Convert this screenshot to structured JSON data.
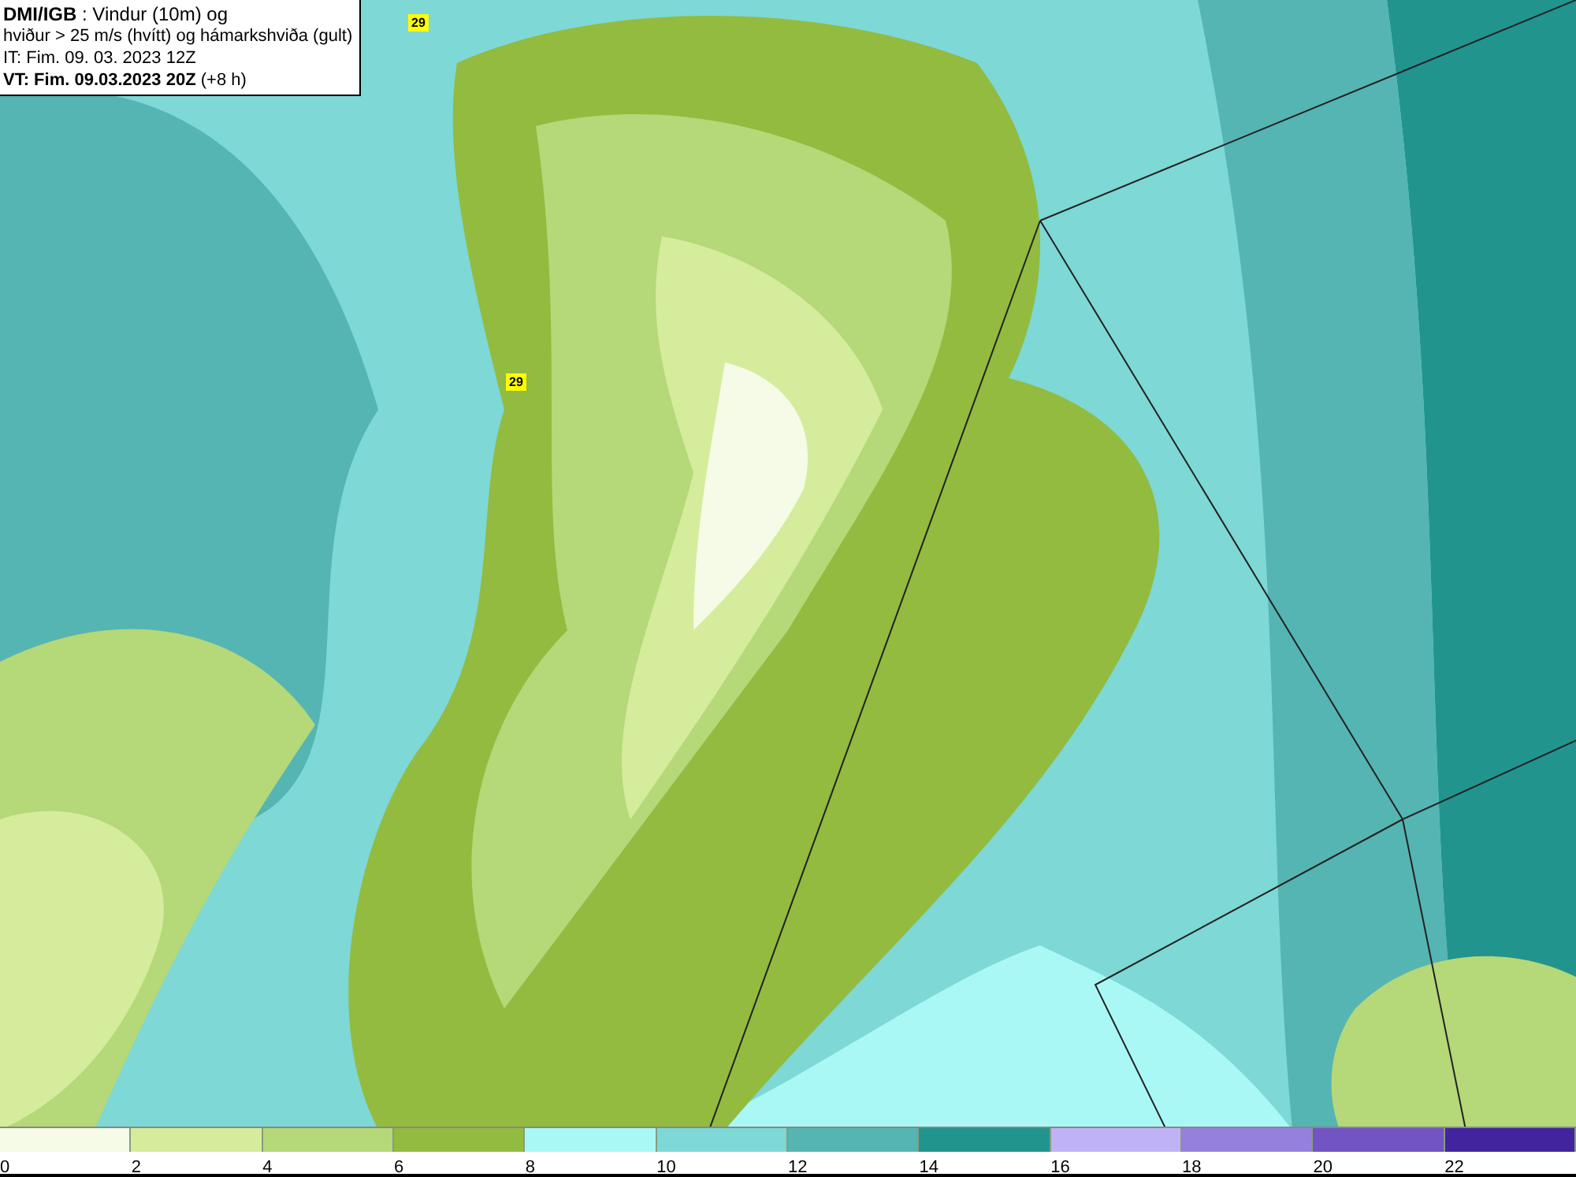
{
  "title_box": {
    "lines": [
      "**DMI/IGB** : Vindur (10m) og",
      "hviður > 25 m/s (hvítt) og hámarkshviða (gult)",
      "IT: Fim. 09. 03. 2023 12Z",
      "**VT: Fim. 09.03.2023 20Z** (+8 h)"
    ]
  },
  "map": {
    "gust_labels": [
      {
        "text": "29"
      },
      {
        "text": "29"
      }
    ]
  },
  "legend": {
    "bins": [
      {
        "color": "#f5fbe6"
      },
      {
        "color": "#d5ec9c"
      },
      {
        "color": "#b5d878"
      },
      {
        "color": "#92bb40"
      },
      {
        "color": "#aaf8f6"
      },
      {
        "color": "#7dd8d6"
      },
      {
        "color": "#55b5b2"
      },
      {
        "color": "#21948e"
      },
      {
        "color": "#c0b3f5"
      },
      {
        "color": "#9580de"
      },
      {
        "color": "#7255c2"
      },
      {
        "color": "#42259e"
      }
    ],
    "labels": [
      "0",
      "2",
      "4",
      "6",
      "8",
      "10",
      "12",
      "14",
      "16",
      "18",
      "20",
      "22"
    ]
  }
}
